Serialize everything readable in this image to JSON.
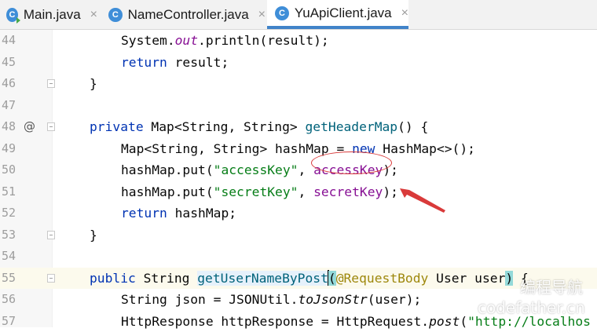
{
  "tabs": [
    {
      "label": "Main.java",
      "icon": "java-class-run-icon",
      "active": false
    },
    {
      "label": "NameController.java",
      "icon": "java-class-icon",
      "active": false
    },
    {
      "label": "YuApiClient.java",
      "icon": "java-class-icon",
      "active": true
    }
  ],
  "tab_close_glyph": "×",
  "class_icon_letter": "C",
  "override_glyph": "@",
  "line_numbers": [
    "44",
    "45",
    "46",
    "47",
    "48",
    "49",
    "50",
    "51",
    "52",
    "53",
    "55",
    "56",
    "57"
  ],
  "code": {
    "l44": {
      "a": "System.",
      "b": "out",
      "c": ".println(result);"
    },
    "l45": {
      "kw": "return",
      "rest": " result;"
    },
    "l46": {
      "text": "}"
    },
    "l48": {
      "kw": "private",
      "a": " Map<String, String> ",
      "fn": "getHeaderMap",
      "b": "() {"
    },
    "l49": {
      "a": "Map<String, String> hashMap = ",
      "kw": "new",
      "b": " HashMap<>();"
    },
    "l50": {
      "a": "hashMap.put(",
      "str": "\"accessKey\"",
      "b": ", ",
      "fld": "accessKey",
      "c": ");"
    },
    "l51": {
      "a": "hashMap.put(",
      "str": "\"secretKey\"",
      "b": ", ",
      "fld": "secretKey",
      "c": ");"
    },
    "l52": {
      "kw": "return",
      "rest": " hashMap;"
    },
    "l53": {
      "text": "}"
    },
    "l55": {
      "kw": "public",
      "a": " String ",
      "fn": "getUserNameByPost",
      "p1": "(",
      "anno": "@RequestBody",
      "b": " User user",
      "p2": ")",
      "c": " {"
    },
    "l56": {
      "a": "String json = JSONUtil.",
      "it": "toJsonStr",
      "b": "(user);"
    },
    "l57": {
      "a": "HttpResponse httpResponse = HttpRequest.",
      "it": "post",
      "b": "(",
      "str": "\"http://localhos"
    }
  },
  "watermark": {
    "line1": "编程导航",
    "line2": "codefather.cn"
  },
  "colors": {
    "keyword": "#0033b3",
    "string": "#067d17",
    "field": "#871094",
    "method": "#00627a",
    "annotation": "#9e880d",
    "tab_accent": "#4083c9",
    "markup": "#d93a3a"
  }
}
